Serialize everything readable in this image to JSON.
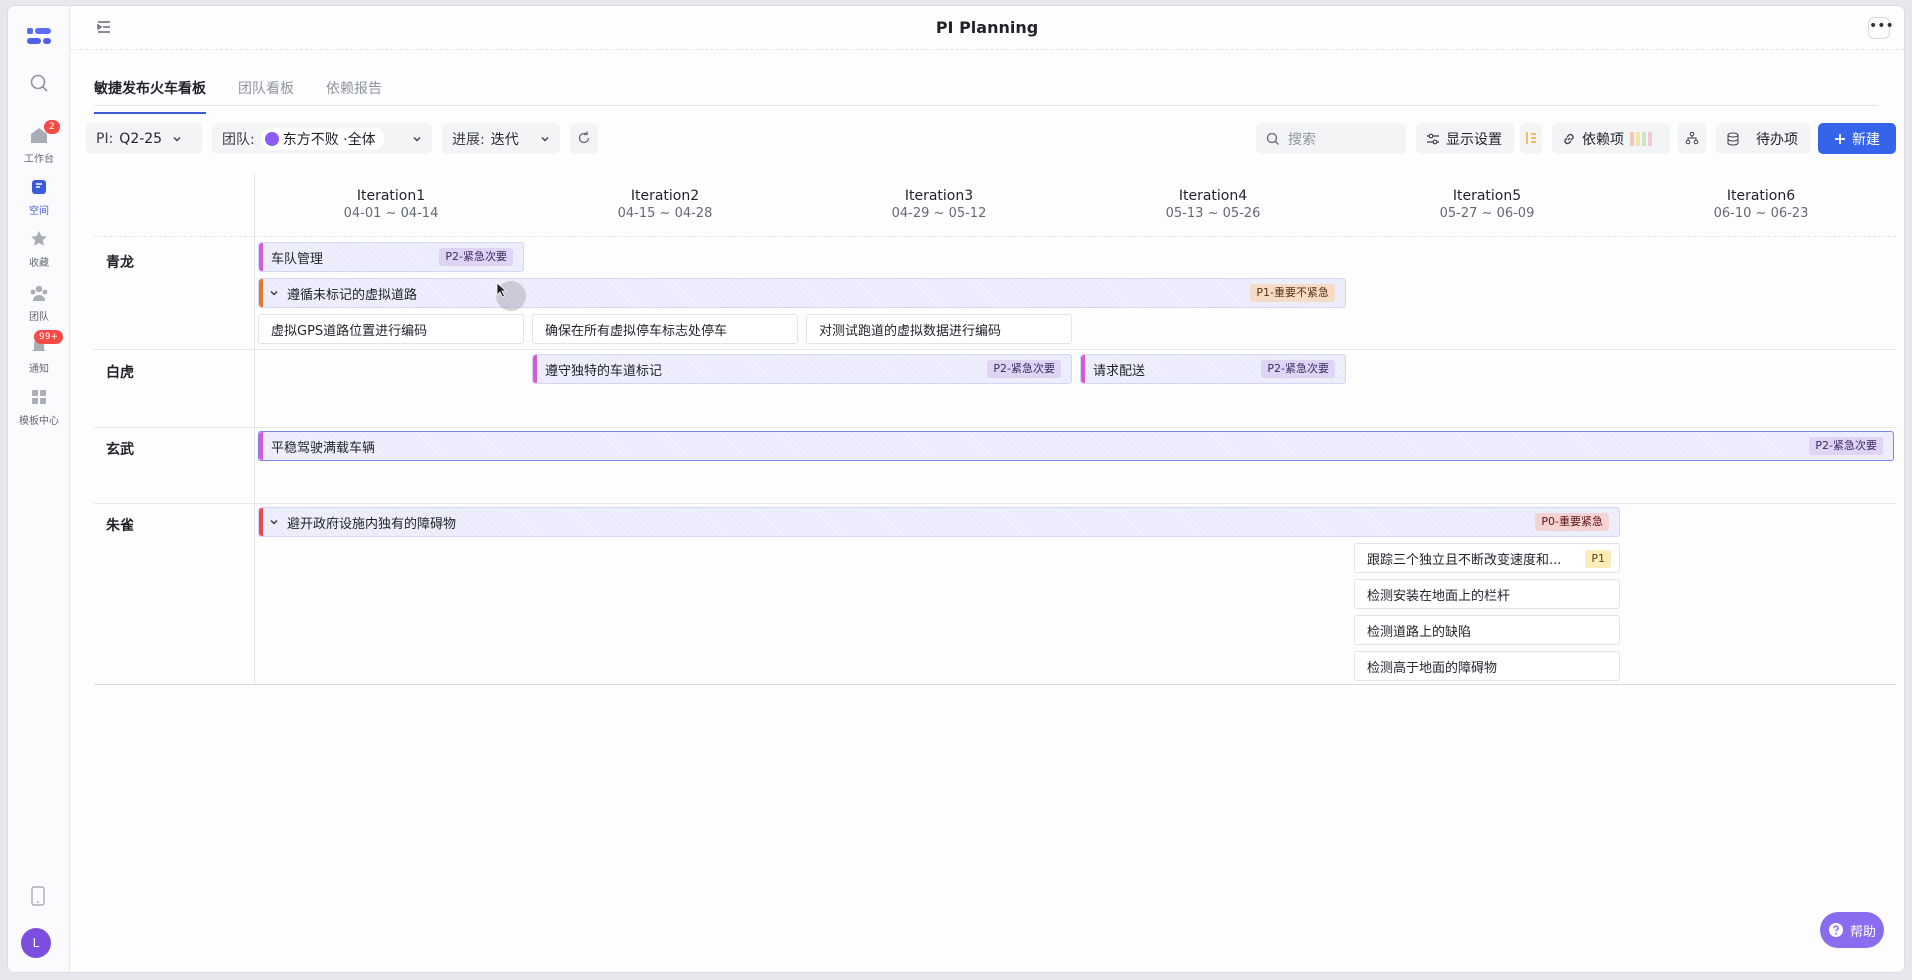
{
  "app": {
    "title": "PI Planning",
    "more": "•••"
  },
  "rail": {
    "items": [
      {
        "label": "工作台",
        "badge": "2"
      },
      {
        "label": "空间"
      },
      {
        "label": "收藏"
      },
      {
        "label": "团队"
      },
      {
        "label": "通知",
        "badge": "99+"
      },
      {
        "label": "模板中心"
      }
    ],
    "avatar": "L"
  },
  "tabs": [
    "敏捷发布火车看板",
    "团队看板",
    "依赖报告"
  ],
  "toolbar": {
    "pi_label": "PI:",
    "pi_value": "Q2-25",
    "team_label": "团队:",
    "team_value": "东方不败 ·全体",
    "progress_label": "进展:",
    "progress_value": "迭代",
    "search_placeholder": "搜索",
    "display_settings": "显示设置",
    "dependencies": "依赖项",
    "backlog": "待办项",
    "new": "新建"
  },
  "iterations": [
    {
      "name": "Iteration1",
      "date": "04-01 ~ 04-14"
    },
    {
      "name": "Iteration2",
      "date": "04-15 ~ 04-28"
    },
    {
      "name": "Iteration3",
      "date": "04-29 ~ 05-12"
    },
    {
      "name": "Iteration4",
      "date": "05-13 ~ 05-26"
    },
    {
      "name": "Iteration5",
      "date": "05-27 ~ 06-09"
    },
    {
      "name": "Iteration6",
      "date": "06-10 ~ 06-23"
    }
  ],
  "lanes": [
    {
      "name": "青龙",
      "features": [
        {
          "label": "车队管理",
          "tag": "P2-紧急次要",
          "color": "#d35bd8"
        },
        {
          "label": "遵循未标记的虚拟道路",
          "tag": "P1-重要不紧急",
          "color": "#e0782e"
        }
      ],
      "stories": [
        "虚拟GPS道路位置进行编码",
        "确保在所有虚拟停车标志处停车",
        "对测试跑道的虚拟数据进行编码"
      ]
    },
    {
      "name": "白虎",
      "features": [
        {
          "label": "遵守独特的车道标记",
          "tag": "P2-紧急次要",
          "color": "#d35bd8"
        },
        {
          "label": "请求配送",
          "tag": "P2-紧急次要",
          "color": "#d35bd8"
        }
      ]
    },
    {
      "name": "玄武",
      "features": [
        {
          "label": "平稳驾驶满载车辆",
          "tag": "P2-紧急次要",
          "color": "#d35bd8"
        }
      ]
    },
    {
      "name": "朱雀",
      "features": [
        {
          "label": "避开政府设施内独有的障碍物",
          "tag": "P0-重要紧急",
          "color": "#e5484d"
        }
      ],
      "stories": [
        "跟踪三个独立且不断改变速度和...",
        "检测安装在地面上的栏杆",
        "检测道路上的缺陷",
        "检测高于地面的障碍物"
      ],
      "first_story_tag": "P1"
    }
  ],
  "help": "帮助",
  "colors": {
    "accent": "#3563e9",
    "help": "#8a6dee"
  }
}
